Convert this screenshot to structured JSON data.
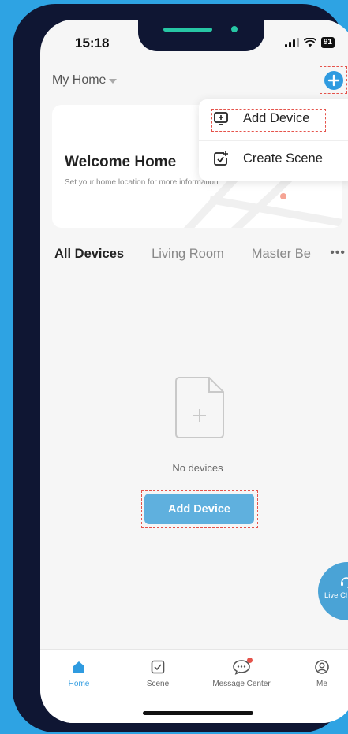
{
  "status_bar": {
    "time": "15:18",
    "battery": "91"
  },
  "header": {
    "home_name": "My Home"
  },
  "welcome": {
    "title": "Welcome Home",
    "subtitle": "Set your home location for more information"
  },
  "popup_menu": {
    "items": [
      {
        "label": "Add Device"
      },
      {
        "label": "Create Scene"
      }
    ]
  },
  "tabs": {
    "items": [
      "All Devices",
      "Living Room",
      "Master Be"
    ],
    "more": "•••"
  },
  "empty_state": {
    "message": "No devices",
    "button_label": "Add Device"
  },
  "live_chat": {
    "label": "Live Chat"
  },
  "bottom_nav": {
    "items": [
      {
        "label": "Home",
        "icon": "home-icon"
      },
      {
        "label": "Scene",
        "icon": "scene-icon"
      },
      {
        "label": "Message Center",
        "icon": "message-icon"
      },
      {
        "label": "Me",
        "icon": "profile-icon"
      }
    ]
  },
  "colors": {
    "accent": "#2f9be0",
    "highlight_border": "#e5534b",
    "background": "#2ea3e3"
  }
}
